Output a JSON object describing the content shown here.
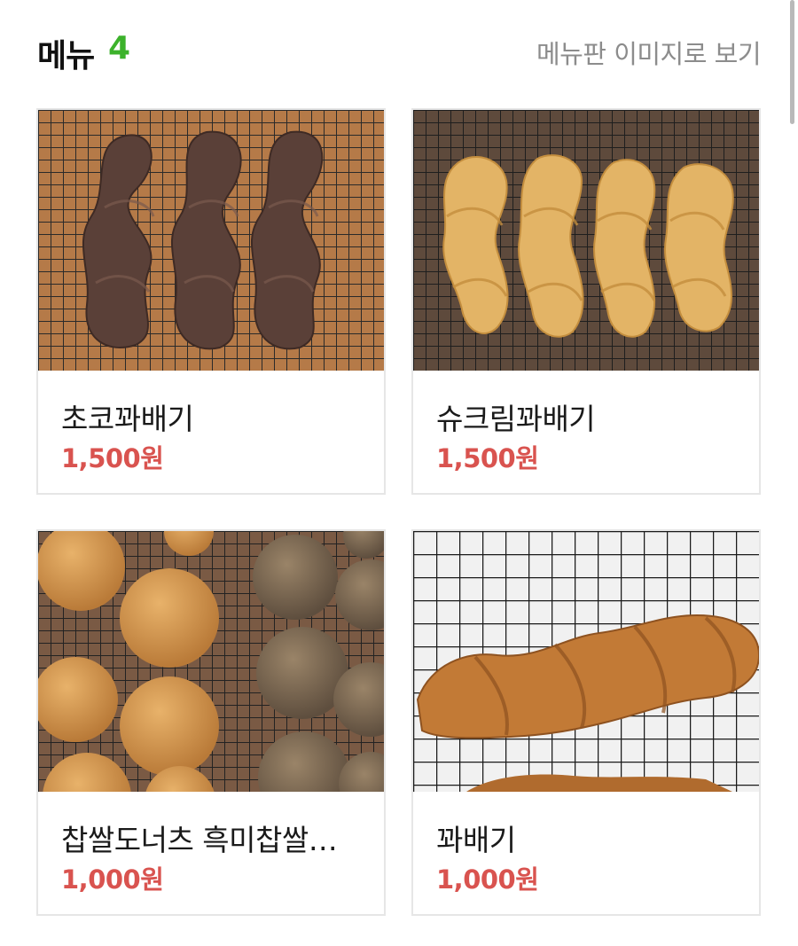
{
  "header": {
    "title": "메뉴",
    "count": "4",
    "board_link": "메뉴판 이미지로 보기"
  },
  "menu": [
    {
      "name": "초코꽈배기",
      "price": "1,500원",
      "photo_icon": "choco-twist-donut-photo"
    },
    {
      "name": "슈크림꽈배기",
      "price": "1,500원",
      "photo_icon": "cream-twist-donut-photo"
    },
    {
      "name": "찹쌀도너츠 흑미찹쌀…",
      "price": "1,000원",
      "photo_icon": "rice-donut-photo"
    },
    {
      "name": "꽈배기",
      "price": "1,000원",
      "photo_icon": "twist-donut-photo"
    }
  ],
  "colors": {
    "count": "#3cb22b",
    "price": "#d9534f",
    "link": "#8c8c8c",
    "card_border": "#e6e6e6"
  }
}
